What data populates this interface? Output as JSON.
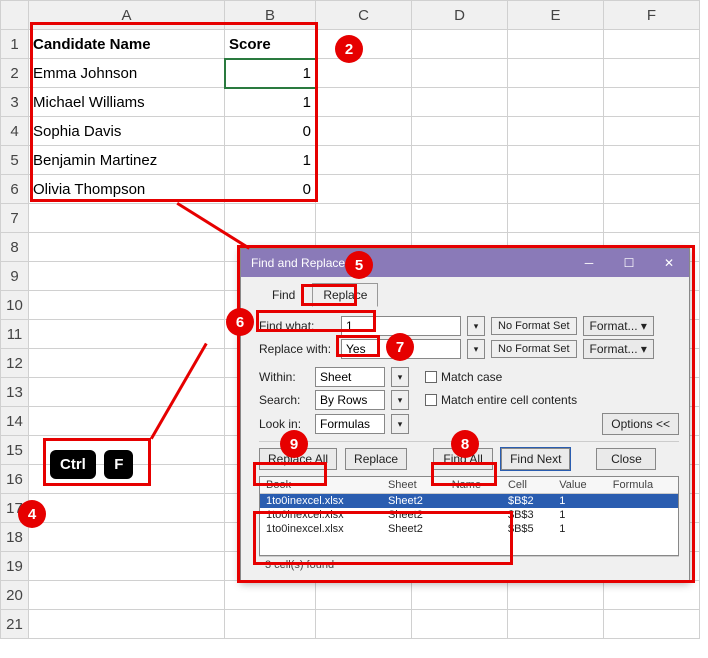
{
  "columns": [
    "A",
    "B",
    "C",
    "D",
    "E",
    "F"
  ],
  "rows": [
    "1",
    "2",
    "3",
    "4",
    "5",
    "6",
    "7",
    "8",
    "9",
    "10",
    "11",
    "12",
    "13",
    "14",
    "15",
    "16",
    "17",
    "18",
    "19",
    "20",
    "21"
  ],
  "header": {
    "name": "Candidate Name",
    "score": "Score"
  },
  "data_rows": [
    {
      "name": "Emma Johnson",
      "score": "1"
    },
    {
      "name": "Michael Williams",
      "score": "1"
    },
    {
      "name": "Sophia Davis",
      "score": "0"
    },
    {
      "name": "Benjamin Martinez",
      "score": "1"
    },
    {
      "name": "Olivia Thompson",
      "score": "0"
    }
  ],
  "chart_data": {
    "type": "table",
    "columns": [
      "Candidate Name",
      "Score"
    ],
    "rows": [
      [
        "Emma Johnson",
        1
      ],
      [
        "Michael Williams",
        1
      ],
      [
        "Sophia Davis",
        0
      ],
      [
        "Benjamin Martinez",
        1
      ],
      [
        "Olivia Thompson",
        0
      ]
    ]
  },
  "keys": {
    "ctrl": "Ctrl",
    "f": "F"
  },
  "dialog": {
    "title": "Find and Replace",
    "tab_find": "Find",
    "tab_replace": "Replace",
    "find_what_lbl": "Find what:",
    "find_what_val": "1",
    "replace_with_lbl": "Replace with:",
    "replace_with_val": "Yes",
    "no_format": "No Format Set",
    "format_btn": "Format...",
    "within_lbl": "Within:",
    "within_val": "Sheet",
    "search_lbl": "Search:",
    "search_val": "By Rows",
    "lookin_lbl": "Look in:",
    "lookin_val": "Formulas",
    "match_case": "Match case",
    "match_entire": "Match entire cell contents",
    "options_btn": "Options <<",
    "replace_all": "Replace All",
    "replace_btn": "Replace",
    "find_all": "Find All",
    "find_next": "Find Next",
    "close_btn": "Close",
    "results_headers": {
      "book": "Book",
      "sheet": "Sheet",
      "name": "Name",
      "cell": "Cell",
      "value": "Value",
      "formula": "Formula"
    },
    "results": [
      {
        "book": "1to0inexcel.xlsx",
        "sheet": "Sheet2",
        "name": "",
        "cell": "$B$2",
        "value": "1"
      },
      {
        "book": "1to0inexcel.xlsx",
        "sheet": "Sheet2",
        "name": "",
        "cell": "$B$3",
        "value": "1"
      },
      {
        "book": "1to0inexcel.xlsx",
        "sheet": "Sheet2",
        "name": "",
        "cell": "$B$5",
        "value": "1"
      }
    ],
    "status": "3 cell(s) found"
  },
  "badges": {
    "b2": "2",
    "b4": "4",
    "b5": "5",
    "b6": "6",
    "b7": "7",
    "b8": "8",
    "b9": "9"
  }
}
